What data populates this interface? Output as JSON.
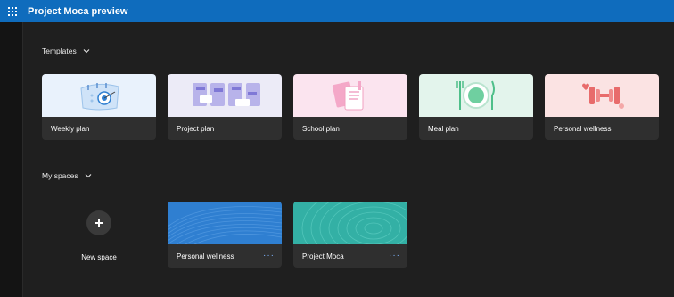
{
  "header": {
    "title": "Project Moca preview",
    "accent": "#0f6cbd"
  },
  "templates": {
    "heading": "Templates",
    "items": [
      {
        "label": "Weekly plan",
        "bg": "#e9f2fc",
        "icon": "calendar-target-icon"
      },
      {
        "label": "Project plan",
        "bg": "#ecebf7",
        "icon": "timeline-board-icon"
      },
      {
        "label": "School plan",
        "bg": "#fbe4ef",
        "icon": "documents-icon"
      },
      {
        "label": "Meal plan",
        "bg": "#e3f4ec",
        "icon": "plate-cutlery-icon"
      },
      {
        "label": "Personal wellness",
        "bg": "#fbe3e3",
        "icon": "dumbbell-icon"
      }
    ]
  },
  "spaces": {
    "heading": "My spaces",
    "new_label": "New space",
    "items": [
      {
        "label": "Personal wellness",
        "more": "···",
        "color": "#2f7fd1"
      },
      {
        "label": "Project Moca",
        "more": "···",
        "color": "#33b0a5"
      }
    ]
  }
}
